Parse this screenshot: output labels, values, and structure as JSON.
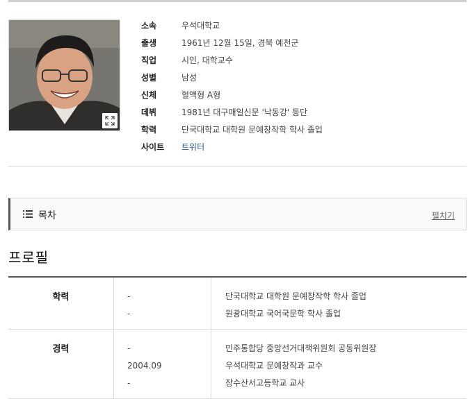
{
  "profile": {
    "photo_alt": "인물 사진",
    "fields": [
      {
        "label": "소속",
        "value": "우석대학교"
      },
      {
        "label": "출생",
        "value": "1961년 12월 15일, 경북 예천군"
      },
      {
        "label": "직업",
        "value": "시인, 대학교수"
      },
      {
        "label": "성별",
        "value": "남성"
      },
      {
        "label": "신체",
        "value": "혈액형 A형"
      },
      {
        "label": "데뷔",
        "value": "1981년 대구매일신문 '낙동강' 등단"
      },
      {
        "label": "학력",
        "value": "단국대학교 대학원 문예창작학 학사 졸업"
      },
      {
        "label": "사이트",
        "value": "트위터"
      }
    ]
  },
  "toc": {
    "title": "목차",
    "toggle": "펼치기"
  },
  "section": {
    "title": "프로필"
  },
  "profile_table": {
    "rows": [
      {
        "header": "학력",
        "entries": [
          {
            "date": "-",
            "desc": "단국대학교 대학원 문예창작학 학사 졸업"
          },
          {
            "date": "-",
            "desc": "원광대학교 국어국문학 학사 졸업"
          }
        ]
      },
      {
        "header": "경력",
        "entries": [
          {
            "date": "-",
            "desc": "민주통합당 중앙선거대책위원회 공동위원장"
          },
          {
            "date": "2004.09",
            "desc": "우석대학교 문예창작과 교수"
          },
          {
            "date": "-",
            "desc": "장수산서고등학교 교사"
          }
        ]
      }
    ]
  }
}
